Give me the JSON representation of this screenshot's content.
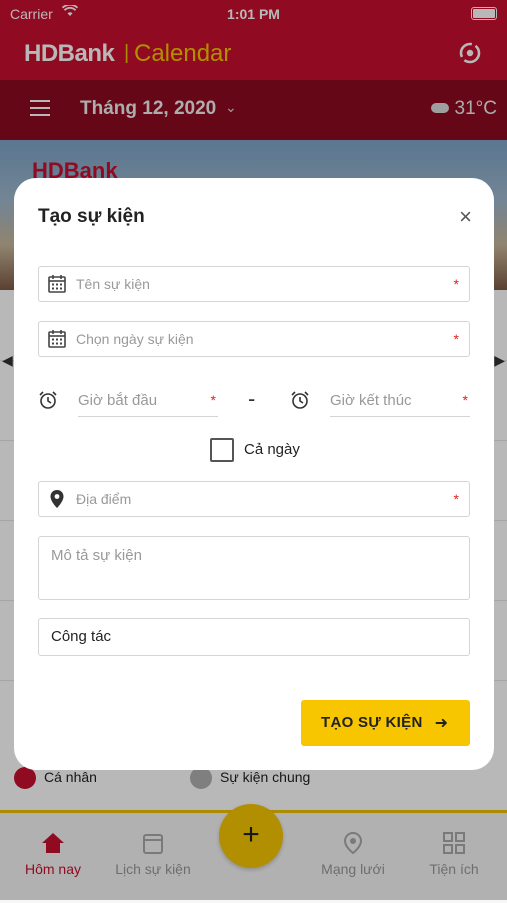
{
  "status_bar": {
    "carrier": "Carrier",
    "time": "1:01 PM"
  },
  "app_bar": {
    "brand": "HDBank",
    "separator": "|",
    "section": "Calendar"
  },
  "month_bar": {
    "month": "Tháng 12, 2020",
    "temperature": "31°C"
  },
  "banner": {
    "logo_text": "HDBank"
  },
  "legend": [
    {
      "label": "Cá nhân",
      "color": "#c8102e"
    },
    {
      "label": "Sự kiện chung",
      "color": "#b0b0b0"
    }
  ],
  "tab_bar": {
    "tabs": [
      {
        "label": "Hôm nay",
        "icon": "home-icon",
        "active": true
      },
      {
        "label": "Lịch sự kiện",
        "icon": "calendar-icon",
        "active": false
      },
      {
        "label": "Mạng lưới",
        "icon": "location-pin-icon",
        "active": false
      },
      {
        "label": "Tiện ích",
        "icon": "grid-icon",
        "active": false
      }
    ],
    "fab_label": "+"
  },
  "modal": {
    "title": "Tạo sự kiện",
    "close": "×",
    "event_name_placeholder": "Tên sự kiện",
    "date_placeholder": "Chọn ngày sự kiện",
    "start_time_placeholder": "Giờ bắt đầu",
    "end_time_placeholder": "Giờ kết thúc",
    "time_separator": "-",
    "all_day_label": "Cả ngày",
    "all_day_checked": false,
    "location_placeholder": "Địa điểm",
    "description_placeholder": "Mô tả sự kiện",
    "category_value": "Công tác",
    "required_mark": "*",
    "submit_label": "TẠO SỰ KIỆN",
    "submit_arrow": "➜"
  },
  "colors": {
    "brand_red": "#c8102e",
    "dark_red": "#8e0b21",
    "accent_yellow": "#f7c600"
  }
}
